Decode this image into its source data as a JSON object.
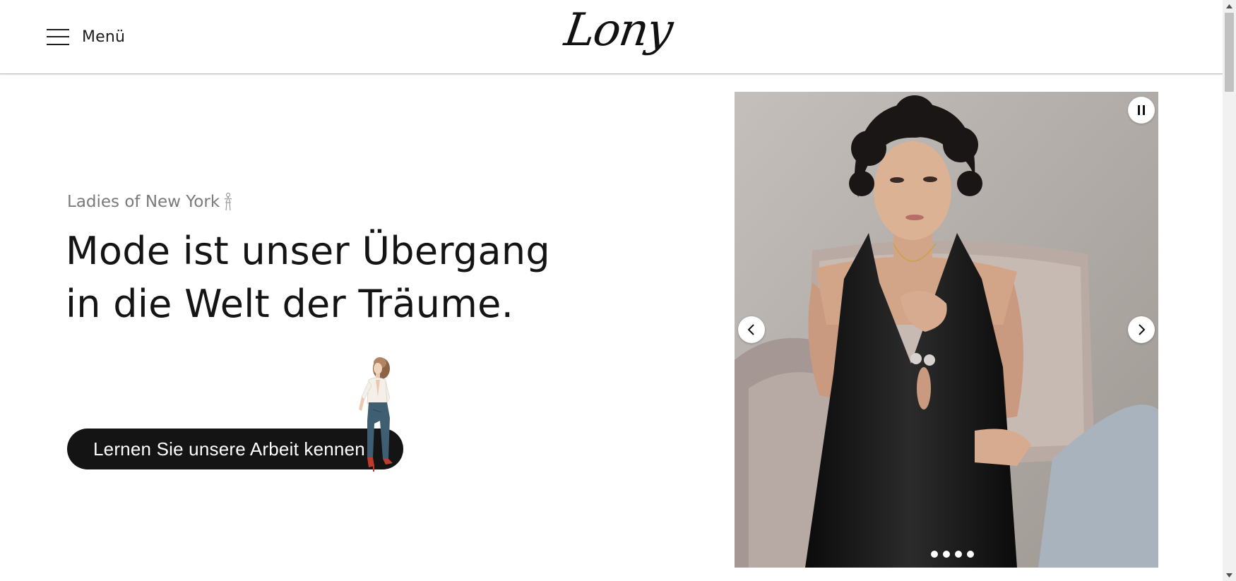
{
  "header": {
    "menu_label": "Menü",
    "logo_text": "Lony"
  },
  "hero": {
    "subheading": "Ladies of New York",
    "headline_line1": "Mode ist unser Übergang",
    "headline_line2": "in die Welt der Träume.",
    "cta_label": "Lernen Sie unsere Arbeit kennen"
  },
  "slider": {
    "slide_count": 4,
    "active_slide": 1,
    "photo_description_icon": "woman-black-dress-photo"
  },
  "colors": {
    "text_primary": "#141414",
    "text_muted": "#7a7a7a",
    "cta_background": "#141414",
    "cta_text": "#ffffff",
    "header_border": "#bdbdbd"
  }
}
